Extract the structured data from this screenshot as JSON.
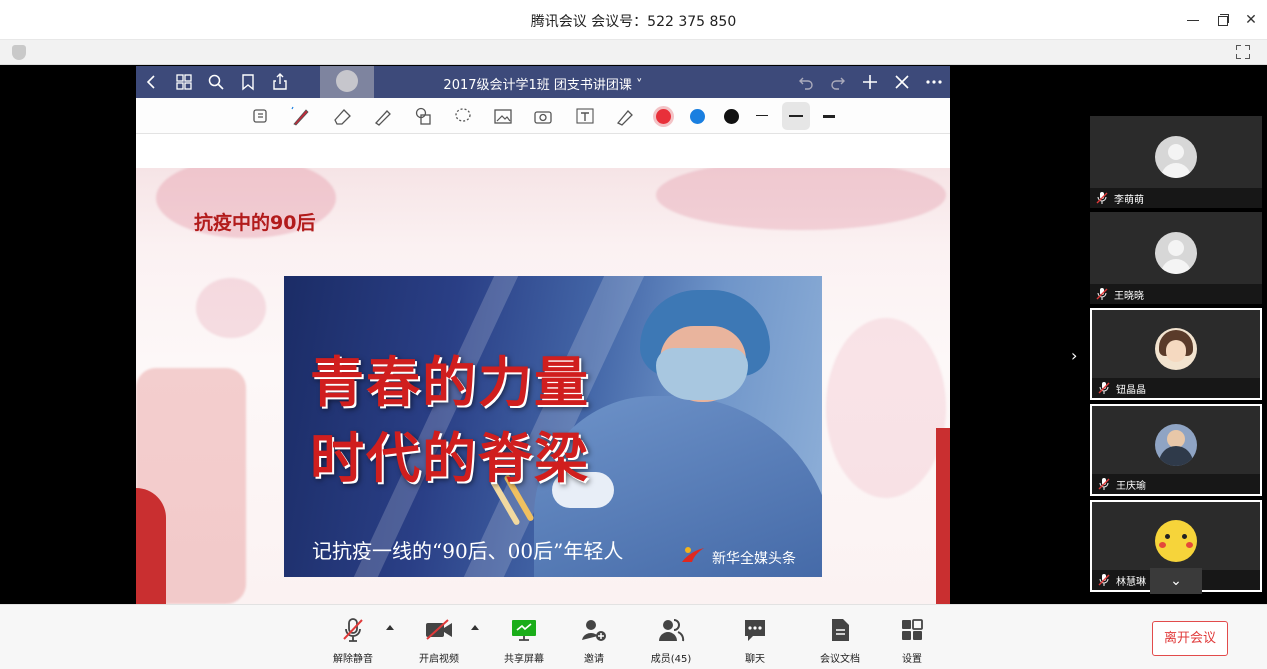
{
  "window": {
    "title": "腾讯会议 会议号：522 375 850"
  },
  "shared_screen": {
    "document_title": "2017级会计学1班 团支书讲团课",
    "pen_colors": [
      "#e8303a",
      "#1a7fe0",
      "#111111"
    ],
    "slide": {
      "title": "抗疫中的90后",
      "headline_1": "青春的力量",
      "headline_2": "时代的脊梁",
      "caption": "记抗疫一线的“90后、00后”年轻人",
      "brand": "新华全媒头条"
    }
  },
  "participants": [
    {
      "name": "李萌萌",
      "avatar": "default-avatar-icon"
    },
    {
      "name": "王晓晓",
      "avatar": "default-avatar-icon"
    },
    {
      "name": "钮晶晶",
      "avatar": "photo-avatar"
    },
    {
      "name": "王庆瑜",
      "avatar": "photo-avatar"
    },
    {
      "name": "林慧琳",
      "avatar": "pikachu-avatar"
    }
  ],
  "toolbar": {
    "unmute": "解除静音",
    "start_video": "开启视频",
    "share_screen": "共享屏幕",
    "invite": "邀请",
    "members": "成员(45)",
    "chat": "聊天",
    "docs": "会议文档",
    "settings": "设置",
    "leave": "离开会议"
  },
  "colors": {
    "accent_green": "#1aad19",
    "leave_red": "#e03a3a",
    "ipad_bar": "#3d4a7a"
  }
}
